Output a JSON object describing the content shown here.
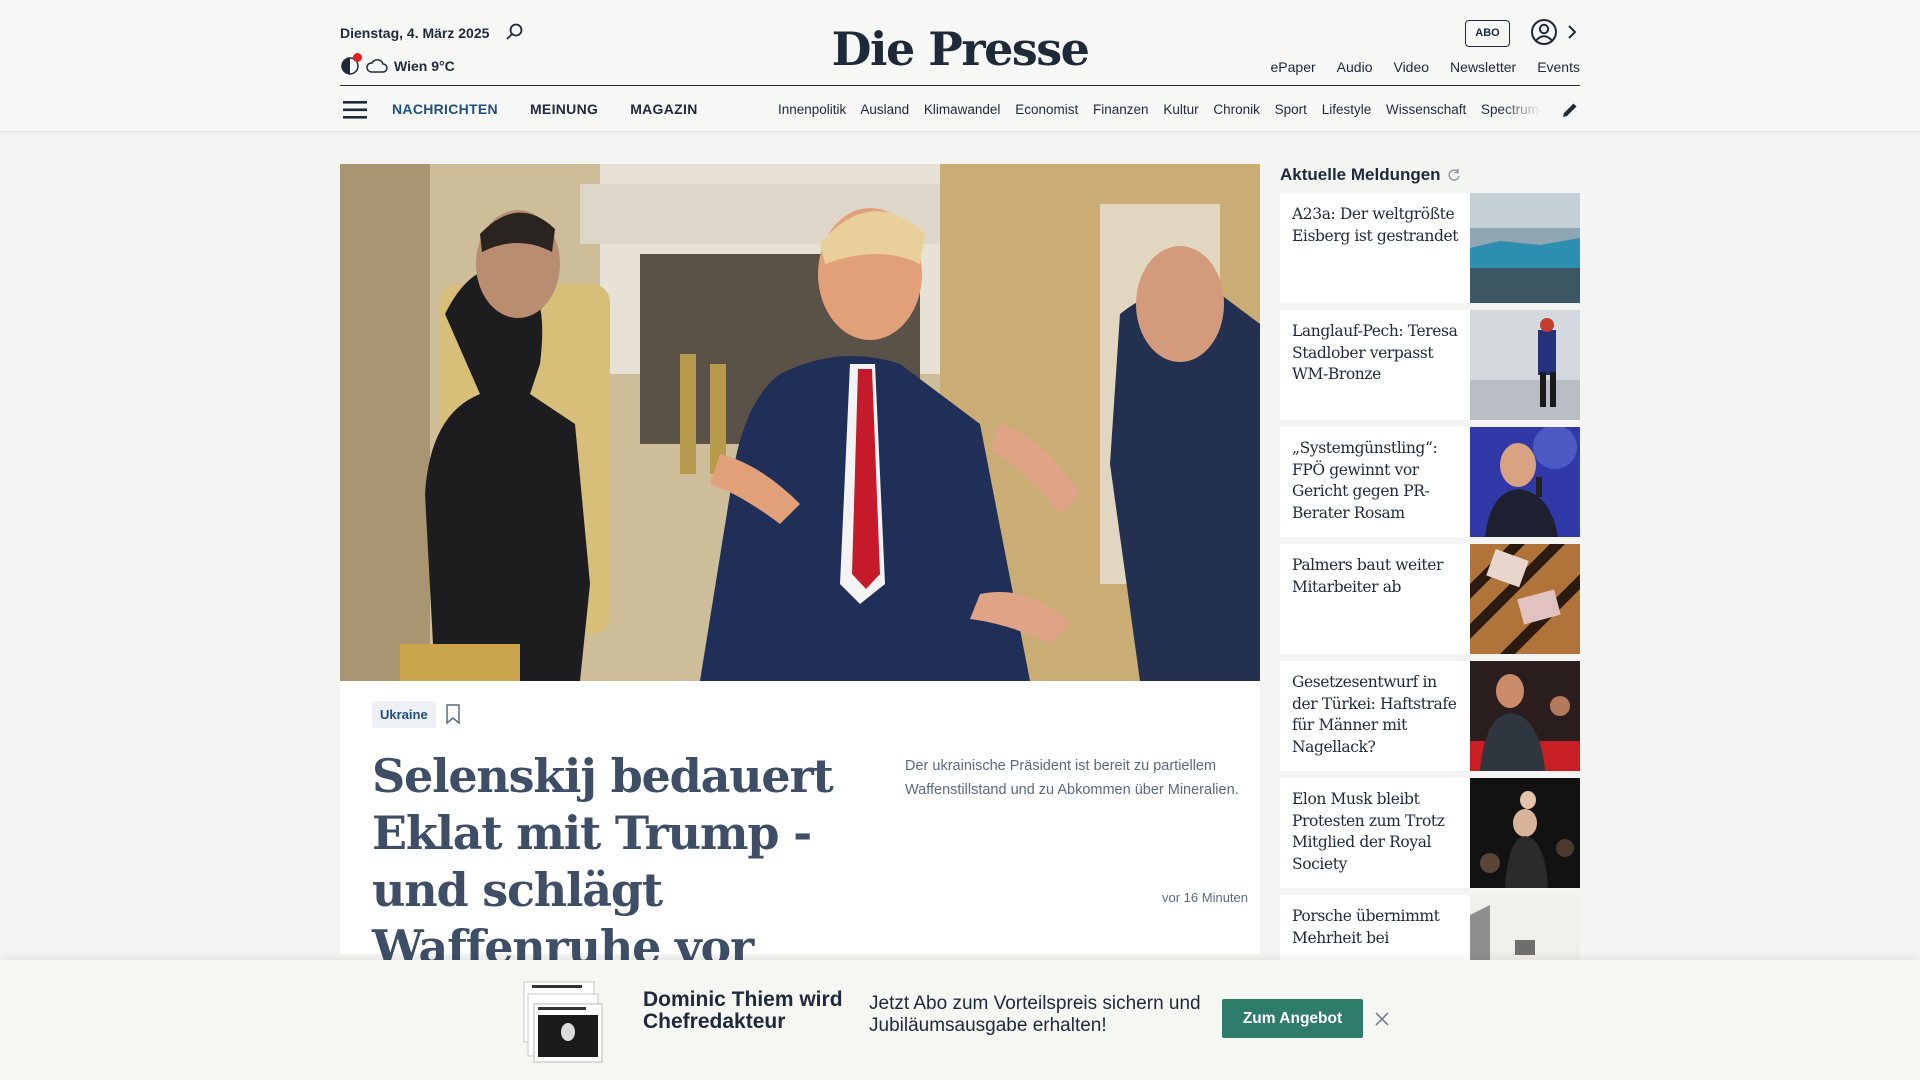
{
  "header": {
    "date": "Dienstag, 4. März 2025",
    "weather": "Wien 9°C",
    "logo": "Die Presse",
    "abo_label": "ABO",
    "top_links": [
      "ePaper",
      "Audio",
      "Video",
      "Newsletter",
      "Events"
    ],
    "main_nav": [
      "NACHRICHTEN",
      "MEINUNG",
      "MAGAZIN"
    ],
    "sub_nav": [
      "Innenpolitik",
      "Ausland",
      "Klimawandel",
      "Economist",
      "Finanzen",
      "Kultur",
      "Chronik",
      "Sport",
      "Lifestyle",
      "Wissenschaft",
      "Spectrum"
    ]
  },
  "icons": {
    "search": "search-icon",
    "theme": "theme-toggle-icon",
    "weather": "cloud-icon",
    "account": "user-account-icon",
    "menu": "hamburger-menu-icon",
    "edit": "pencil-icon",
    "bookmark": "bookmark-icon",
    "refresh": "refresh-icon",
    "close": "close-icon"
  },
  "hero": {
    "tag": "Ukraine",
    "headline": "Selenskij bedauert Eklat mit Trump - und schlägt Waffenruhe vor",
    "teaser": "Der ukrainische Präsident ist bereit zu partiellem Waffenstillstand und zu Abkommen über Mineralien.",
    "time": "vor 16 Minuten"
  },
  "sidebar": {
    "title": "Aktuelle Meldungen",
    "items": [
      {
        "title": "A23a: Der weltgrößte Eisberg ist gestrandet"
      },
      {
        "title": "Langlauf-Pech: Teresa Stadlober verpasst WM-Bronze"
      },
      {
        "title": "„Systemgünstling“: FPÖ gewinnt vor Gericht gegen PR-Berater Rosam"
      },
      {
        "title": "Palmers baut weiter Mitarbeiter ab"
      },
      {
        "title": "Gesetzesentwurf in der Türkei: Haftstrafe für Männer mit Nagellack?"
      },
      {
        "title": "Elon Musk bleibt Protesten zum Trotz Mitglied der Royal Society"
      },
      {
        "title": "Porsche übernimmt Mehrheit bei"
      }
    ]
  },
  "promo": {
    "title": "Dominic Thiem wird Chefredakteur",
    "text": "Jetzt Abo zum Vorteilspreis sichern und Jubiläumsausgabe erhalten!",
    "button": "Zum Angebot"
  },
  "colors": {
    "brand_navy": "#1e2a3a",
    "nav_active": "#1d4f80",
    "headline": "#3e4e66",
    "cta_green": "#2e7d6b",
    "alert_red": "#e0201f"
  }
}
